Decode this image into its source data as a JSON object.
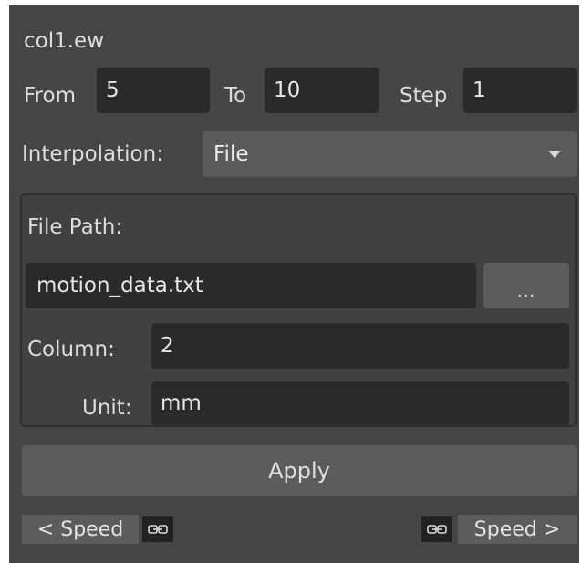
{
  "panel": {
    "title": "col1.ew"
  },
  "range": {
    "from_label": "From",
    "from_value": "5",
    "to_label": "To",
    "to_value": "10",
    "step_label": "Step",
    "step_value": "1"
  },
  "interpolation": {
    "label": "Interpolation:",
    "selected": "File",
    "caret_icon": "chevron-down-icon"
  },
  "file_group": {
    "path_label": "File Path:",
    "path_value": "motion_data.txt",
    "browse_label": "...",
    "column_label": "Column:",
    "column_value": "2",
    "unit_label": "Unit:",
    "unit_value": "mm"
  },
  "actions": {
    "apply_label": "Apply"
  },
  "speed": {
    "left_label": "< Speed",
    "right_label": "Speed >",
    "link_icon": "link-icon"
  },
  "colors": {
    "panel_bg": "#454545",
    "field_bg": "#2a2a2a",
    "button_bg": "#5c5c5c",
    "text": "#dcdcdc"
  }
}
